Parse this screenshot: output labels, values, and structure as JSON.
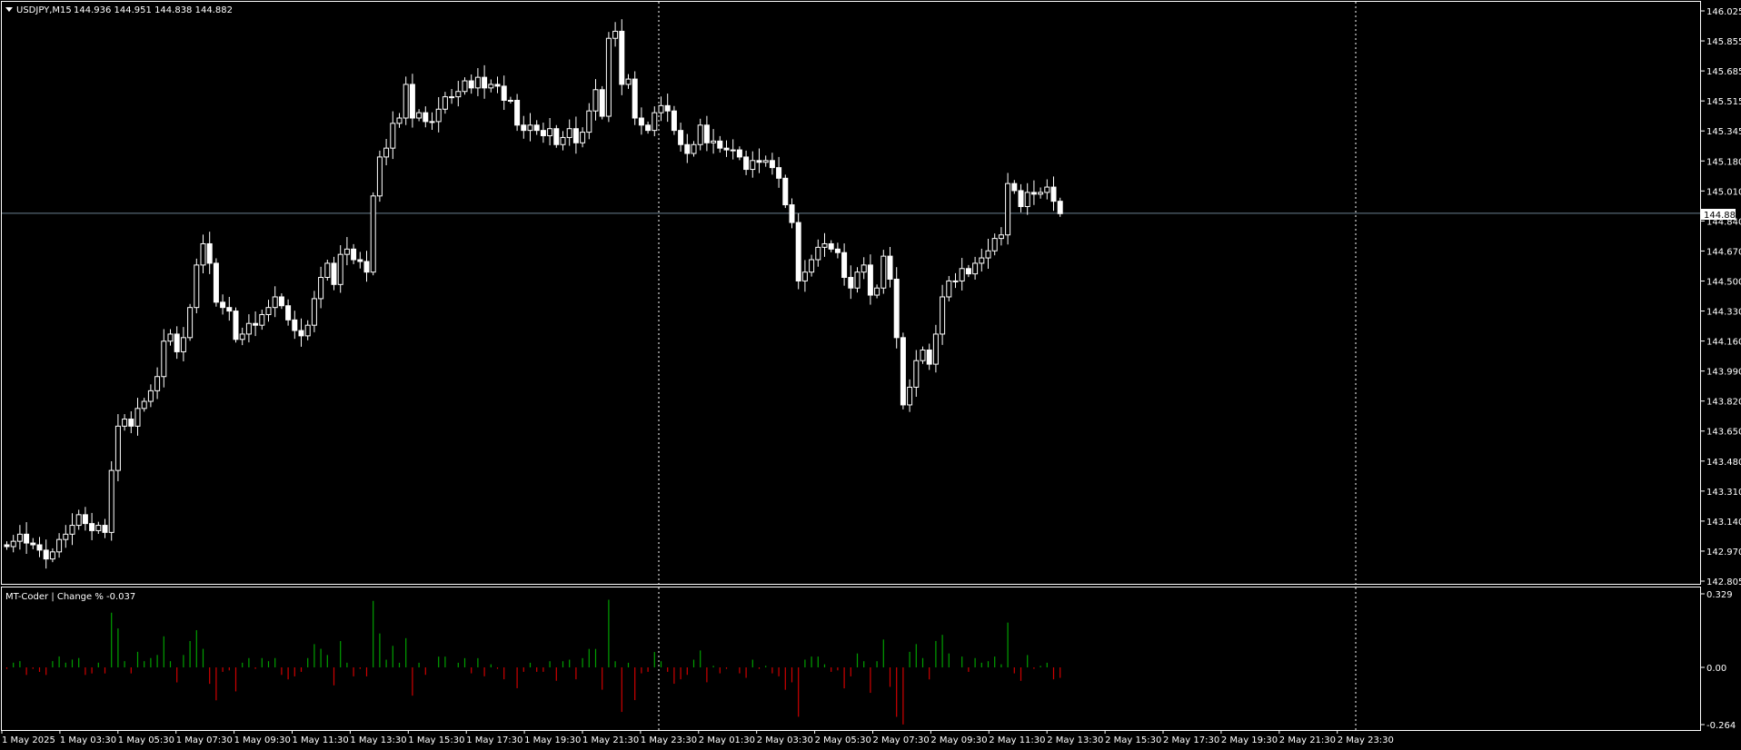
{
  "window": {
    "symbol_label": "USDJPY,M15",
    "ohlc_label": "144.936 144.951 144.838 144.882",
    "current_price_label": "144.882"
  },
  "indicator": {
    "label": "MT-Coder | Change % -0.037",
    "axis_labels": [
      "0.329",
      "0.00",
      "-0.264"
    ]
  },
  "price_axis": {
    "labels": [
      "146.025",
      "145.855",
      "145.685",
      "145.515",
      "145.345",
      "145.180",
      "145.010",
      "144.840",
      "144.670",
      "144.500",
      "144.330",
      "144.160",
      "143.990",
      "143.820",
      "143.650",
      "143.480",
      "143.310",
      "143.140",
      "142.970",
      "142.805"
    ]
  },
  "time_axis": {
    "labels": [
      "1 May 2025",
      "1 May 03:30",
      "1 May 05:30",
      "1 May 07:30",
      "1 May 09:30",
      "1 May 11:30",
      "1 May 13:30",
      "1 May 15:30",
      "1 May 17:30",
      "1 May 19:30",
      "1 May 21:30",
      "1 May 23:30",
      "2 May 01:30",
      "2 May 03:30",
      "2 May 05:30",
      "2 May 07:30",
      "2 May 09:30",
      "2 May 11:30",
      "2 May 13:30",
      "2 May 15:30",
      "2 May 17:30",
      "2 May 19:30",
      "2 May 21:30",
      "2 May 23:30"
    ]
  },
  "colors": {
    "background": "#000000",
    "candle_up": "#000000",
    "candle_down": "#ffffff",
    "candle_outline": "#ffffff",
    "hist_positive": "#00a000",
    "hist_negative": "#d00000",
    "bid_line": "#6b7f8f",
    "separator": "#ffffff"
  },
  "chart_data": {
    "type": "candlestick",
    "symbol": "USDJPY",
    "timeframe": "M15",
    "price_range": [
      142.805,
      146.025
    ],
    "current_price": 144.882,
    "indicator_range": [
      -0.264,
      0.329
    ],
    "closes": [
      143.0,
      143.03,
      143.07,
      143.02,
      143.01,
      142.98,
      142.93,
      142.97,
      143.04,
      143.07,
      143.12,
      143.18,
      143.13,
      143.09,
      143.12,
      143.08,
      143.43,
      143.68,
      143.72,
      143.68,
      143.78,
      143.82,
      143.88,
      143.96,
      144.16,
      144.2,
      144.1,
      144.18,
      144.35,
      144.59,
      144.71,
      144.6,
      144.38,
      144.35,
      144.33,
      144.17,
      144.2,
      144.26,
      144.25,
      144.31,
      144.35,
      144.41,
      144.36,
      144.28,
      144.22,
      144.19,
      144.25,
      144.4,
      144.52,
      144.6,
      144.48,
      144.65,
      144.68,
      144.62,
      144.61,
      144.55,
      144.98,
      145.2,
      145.25,
      145.39,
      145.42,
      145.61,
      145.42,
      145.45,
      145.4,
      145.4,
      145.47,
      145.54,
      145.54,
      145.57,
      145.63,
      145.59,
      145.65,
      145.59,
      145.61,
      145.6,
      145.52,
      145.52,
      145.38,
      145.35,
      145.38,
      145.35,
      145.32,
      145.36,
      145.27,
      145.31,
      145.36,
      145.28,
      145.34,
      145.46,
      145.58,
      145.43,
      145.87,
      145.91,
      145.61,
      145.64,
      145.42,
      145.38,
      145.35,
      145.45,
      145.49,
      145.46,
      145.35,
      145.27,
      145.22,
      145.27,
      145.38,
      145.28,
      145.29,
      145.25,
      145.24,
      145.24,
      145.2,
      145.13,
      145.18,
      145.17,
      145.18,
      145.14,
      145.08,
      144.93,
      144.83,
      144.5,
      144.55,
      144.62,
      144.69,
      144.71,
      144.68,
      144.66,
      144.52,
      144.46,
      144.55,
      144.59,
      144.42,
      144.46,
      144.64,
      144.51,
      144.18,
      143.8,
      143.9,
      144.05,
      144.11,
      144.03,
      144.2,
      144.41,
      144.5,
      144.5,
      144.57,
      144.54,
      144.6,
      144.63,
      144.67,
      144.74,
      144.76,
      145.05,
      145.01,
      144.92,
      145.0,
      144.99,
      145.0,
      145.03,
      144.95,
      144.88
    ],
    "opens": [
      143.01,
      143.0,
      143.03,
      143.07,
      143.02,
      143.01,
      142.98,
      142.93,
      142.97,
      143.04,
      143.07,
      143.12,
      143.18,
      143.13,
      143.09,
      143.12,
      143.08,
      143.43,
      143.68,
      143.72,
      143.68,
      143.78,
      143.82,
      143.88,
      143.96,
      144.16,
      144.2,
      144.1,
      144.18,
      144.35,
      144.59,
      144.71,
      144.6,
      144.38,
      144.35,
      144.33,
      144.17,
      144.2,
      144.26,
      144.25,
      144.31,
      144.35,
      144.41,
      144.36,
      144.28,
      144.22,
      144.19,
      144.25,
      144.4,
      144.52,
      144.6,
      144.48,
      144.65,
      144.68,
      144.62,
      144.61,
      144.55,
      144.98,
      145.2,
      145.25,
      145.39,
      145.42,
      145.61,
      145.42,
      145.45,
      145.4,
      145.4,
      145.47,
      145.54,
      145.54,
      145.57,
      145.63,
      145.59,
      145.65,
      145.59,
      145.61,
      145.6,
      145.52,
      145.52,
      145.38,
      145.35,
      145.38,
      145.35,
      145.32,
      145.36,
      145.27,
      145.31,
      145.36,
      145.28,
      145.34,
      145.46,
      145.58,
      145.43,
      145.87,
      145.91,
      145.61,
      145.64,
      145.42,
      145.38,
      145.35,
      145.45,
      145.49,
      145.46,
      145.35,
      145.27,
      145.22,
      145.27,
      145.38,
      145.28,
      145.29,
      145.25,
      145.24,
      145.24,
      145.2,
      145.13,
      145.18,
      145.17,
      145.18,
      145.14,
      145.08,
      144.93,
      144.83,
      144.5,
      144.55,
      144.62,
      144.69,
      144.71,
      144.68,
      144.66,
      144.52,
      144.46,
      144.55,
      144.59,
      144.42,
      144.46,
      144.64,
      144.51,
      144.18,
      143.8,
      143.9,
      144.05,
      144.11,
      144.03,
      144.2,
      144.41,
      144.5,
      144.5,
      144.57,
      144.54,
      144.6,
      144.63,
      144.67,
      144.74,
      144.76,
      145.05,
      145.01,
      144.92,
      145.0,
      144.99,
      145.0,
      145.03,
      144.95
    ]
  }
}
